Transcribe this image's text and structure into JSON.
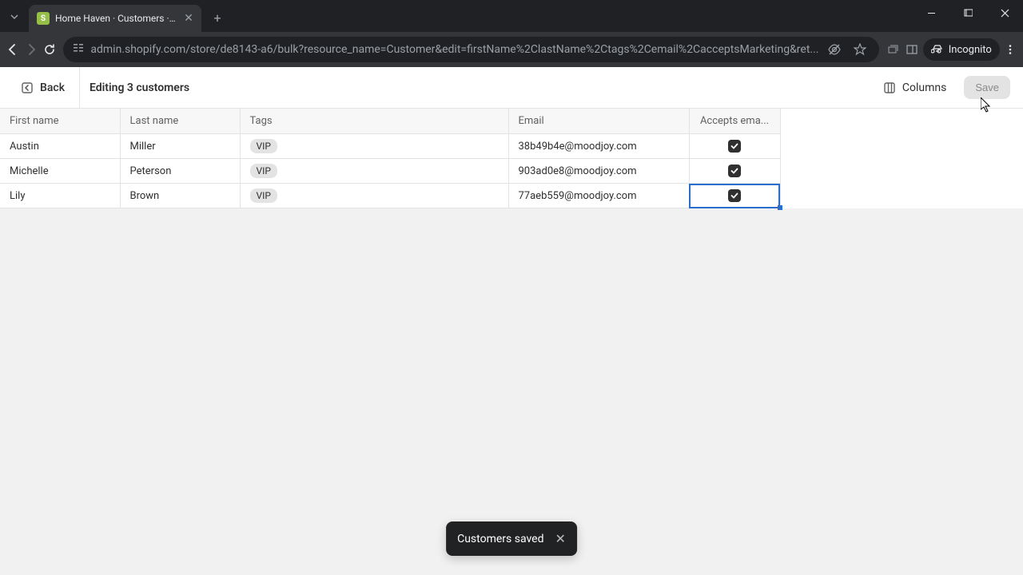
{
  "browser": {
    "tab_title": "Home Haven · Customers · Sho",
    "url": "admin.shopify.com/store/de8143-a6/bulk?resource_name=Customer&edit=firstName%2ClastName%2Ctags%2Cemail%2CacceptsMarketing&ret...",
    "incognito_label": "Incognito"
  },
  "header": {
    "back_label": "Back",
    "title": "Editing 3 customers",
    "columns_label": "Columns",
    "save_label": "Save"
  },
  "table": {
    "columns": {
      "first_name": "First name",
      "last_name": "Last name",
      "tags": "Tags",
      "email": "Email",
      "accepts": "Accepts ema..."
    },
    "rows": [
      {
        "first_name": "Austin",
        "last_name": "Miller",
        "tag": "VIP",
        "email": "38b49b4e@moodjoy.com",
        "accepts": true,
        "selected": false
      },
      {
        "first_name": "Michelle",
        "last_name": "Peterson",
        "tag": "VIP",
        "email": "903ad0e8@moodjoy.com",
        "accepts": true,
        "selected": false
      },
      {
        "first_name": "Lily",
        "last_name": "Brown",
        "tag": "VIP",
        "email": "77aeb559@moodjoy.com",
        "accepts": true,
        "selected": true
      }
    ]
  },
  "toast": {
    "message": "Customers saved"
  }
}
